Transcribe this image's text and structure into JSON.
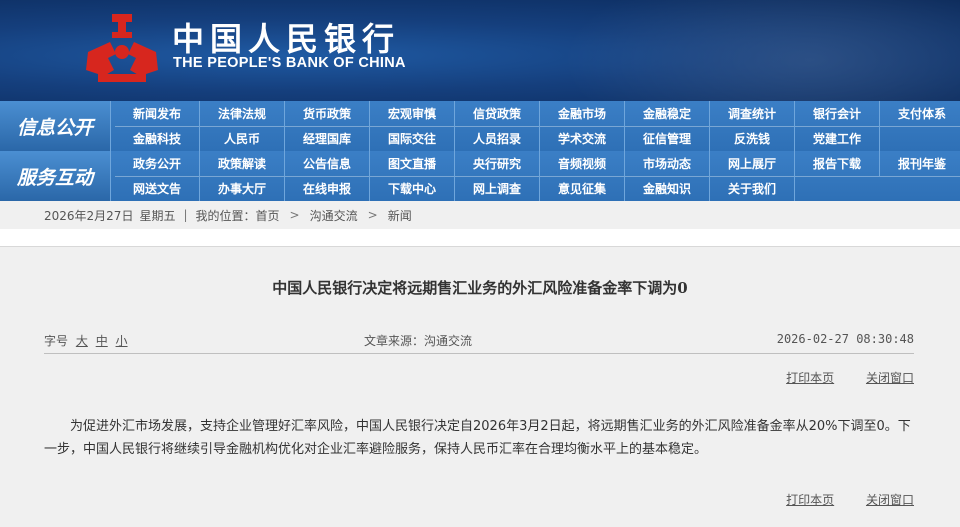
{
  "header": {
    "title_cn": "中国人民银行",
    "title_en": "THE PEOPLE'S BANK OF CHINA",
    "colors": {
      "bg": "#153f7d",
      "emblem": "#d7261e"
    }
  },
  "nav": [
    {
      "label": "信息公开",
      "rows": [
        [
          "新闻发布",
          "法律法规",
          "货币政策",
          "宏观审慎",
          "信贷政策",
          "金融市场",
          "金融稳定",
          "调查统计",
          "银行会计",
          "支付体系"
        ],
        [
          "金融科技",
          "人民币",
          "经理国库",
          "国际交往",
          "人员招录",
          "学术交流",
          "征信管理",
          "反洗钱",
          "党建工作",
          ""
        ]
      ]
    },
    {
      "label": "服务互动",
      "rows": [
        [
          "政务公开",
          "政策解读",
          "公告信息",
          "图文直播",
          "央行研究",
          "音频视频",
          "市场动态",
          "网上展厅",
          "报告下载",
          "报刊年鉴"
        ],
        [
          "网送文告",
          "办事大厅",
          "在线申报",
          "下载中心",
          "网上调查",
          "意见征集",
          "金融知识",
          "关于我们",
          "",
          ""
        ]
      ]
    }
  ],
  "breadcrumb": {
    "date": "2026年2月27日",
    "weekday": "星期五",
    "sep": "|",
    "location_label": "我的位置：",
    "items": [
      "首页",
      "沟通交流",
      "新闻"
    ],
    "arrow": ">"
  },
  "article": {
    "title": "中国人民银行决定将远期售汇业务的外汇风险准备金率下调为0",
    "font_size_label": "字号",
    "font_sizes": [
      "大",
      "中",
      "小"
    ],
    "source": "文章来源：沟通交流",
    "datetime": "2026-02-27  08:30:48",
    "print_label": "打印本页",
    "close_label": "关闭窗口",
    "body": "为促进外汇市场发展，支持企业管理好汇率风险，中国人民银行决定自2026年3月2日起，将远期售汇业务的外汇风险准备金率从20%下调至0。下一步，中国人民银行将继续引导金融机构优化对企业汇率避险服务，保持人民币汇率在合理均衡水平上的基本稳定。"
  }
}
